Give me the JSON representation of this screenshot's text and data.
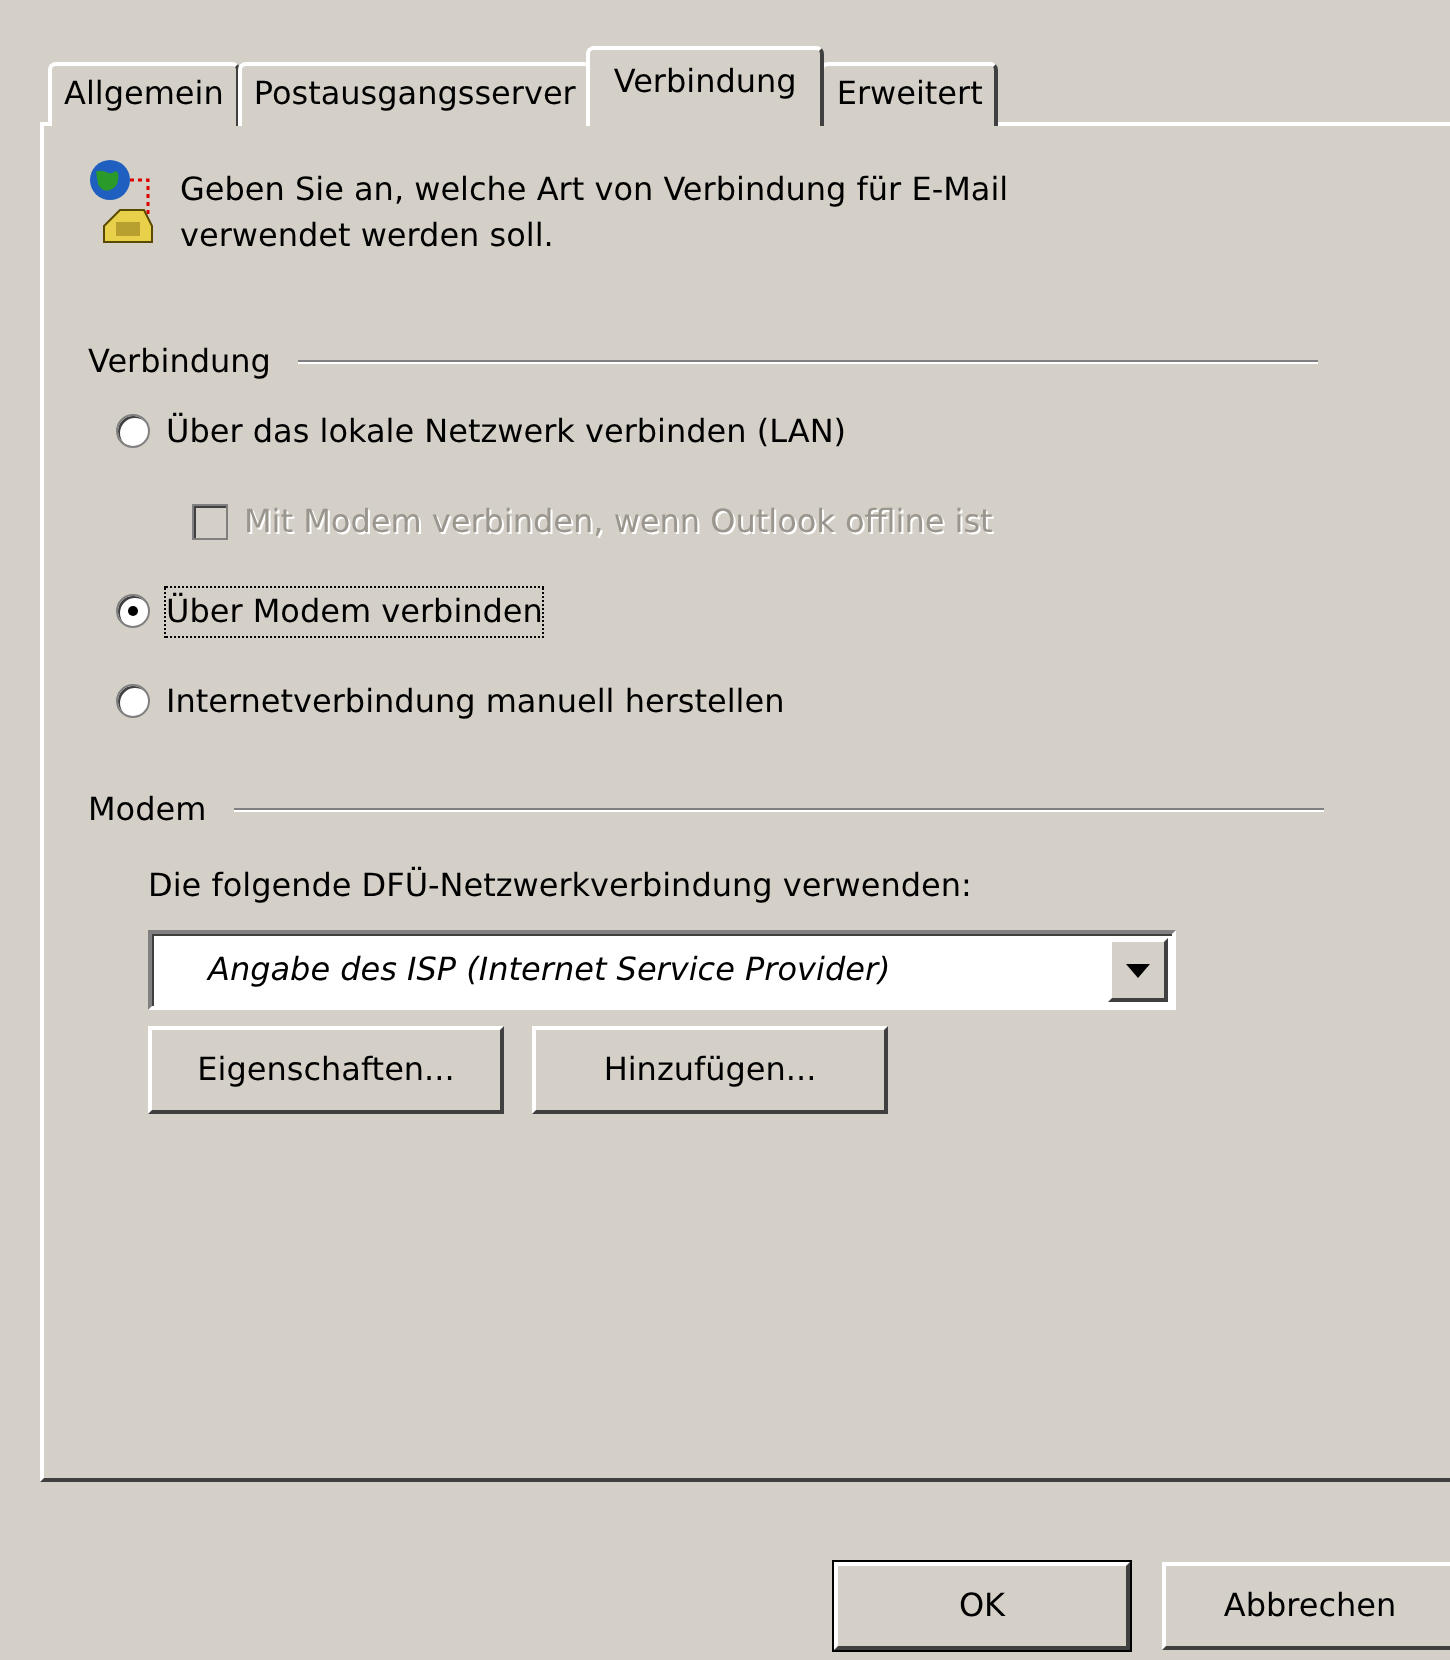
{
  "tabs": [
    {
      "label": "Allgemein",
      "selected": false
    },
    {
      "label": "Postausgangsserver",
      "selected": false
    },
    {
      "label": "Verbindung",
      "selected": true
    },
    {
      "label": "Erweitert",
      "selected": false
    }
  ],
  "intro": "Geben Sie an, welche Art von Verbindung für E-Mail verwendet werden soll.",
  "connection_group": {
    "title": "Verbindung",
    "options": [
      {
        "kind": "radio",
        "label": "Über das lokale Netzwerk verbinden (LAN)",
        "selected": false,
        "disabled": false,
        "focused": false
      },
      {
        "kind": "checkbox",
        "label": "Mit Modem verbinden, wenn Outlook offline ist",
        "checked": false,
        "disabled": true,
        "focused": false
      },
      {
        "kind": "radio",
        "label": "Über Modem verbinden",
        "selected": true,
        "disabled": false,
        "focused": true
      },
      {
        "kind": "radio",
        "label": "Internetverbindung manuell herstellen",
        "selected": false,
        "disabled": false,
        "focused": false
      }
    ]
  },
  "modem_group": {
    "title": "Modem",
    "label": "Die folgende DFÜ-Netzwerkverbindung verwenden:",
    "dropdown": {
      "value": "Angabe des ISP (Internet Service Provider)"
    },
    "buttons": [
      {
        "label": "Eigenschaften..."
      },
      {
        "label": "Hinzufügen..."
      }
    ]
  },
  "dialog_buttons": [
    {
      "label": "OK",
      "default": true
    },
    {
      "label": "Abbrechen",
      "default": false
    }
  ]
}
